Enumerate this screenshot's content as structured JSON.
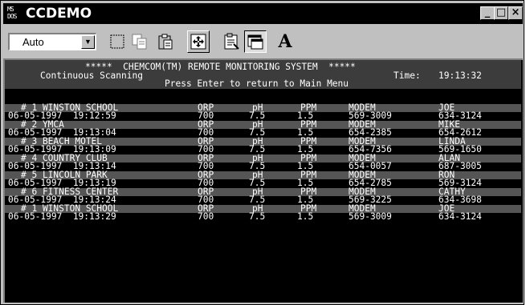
{
  "window": {
    "icon_top": "MS",
    "icon_bottom": "DOS",
    "title": "CCDEMO",
    "min_glyph": "_",
    "max_glyph": "□",
    "close_glyph": "×"
  },
  "toolbar": {
    "font_size_value": "Auto",
    "dropdown_glyph": "▼",
    "font_button_label": "A"
  },
  "terminal": {
    "header_line1": "*****  CHEMCOM(TM) REMOTE MONITORING SYSTEM  *****",
    "header_line2_left": "Continuous Scanning",
    "header_time_label": "Time:",
    "header_time_value": "19:13:32",
    "header_line3": "Press Enter to return to Main Menu",
    "columns": [
      "ORP",
      "pH",
      "PPM",
      "MODEM"
    ],
    "records": [
      {
        "site": "# 1 WINSTON SCHOOL",
        "datetime": "06-05-1997  19:12:59",
        "orp": "700",
        "ph": "7.5",
        "ppm": "1.5",
        "modem": "569-3009",
        "contact": "JOE",
        "phone": "634-3124"
      },
      {
        "site": "# 2 YMCA",
        "datetime": "06-05-1997  19:13:04",
        "orp": "700",
        "ph": "7.5",
        "ppm": "1.5",
        "modem": "654-2385",
        "contact": "MIKE",
        "phone": "654-2612"
      },
      {
        "site": "# 3 BEACH MOTEL",
        "datetime": "06-05-1997  19:13:09",
        "orp": "700",
        "ph": "7.5",
        "ppm": "1.5",
        "modem": "654-7356",
        "contact": "LINDA",
        "phone": "569-1650"
      },
      {
        "site": "# 4 COUNTRY CLUB",
        "datetime": "06-05-1997  19:13:14",
        "orp": "700",
        "ph": "7.5",
        "ppm": "1.5",
        "modem": "654-0057",
        "contact": "ALAN",
        "phone": "687-3005"
      },
      {
        "site": "# 5 LINCOLN PARK",
        "datetime": "06-05-1997  19:13:19",
        "orp": "700",
        "ph": "7.5",
        "ppm": "1.5",
        "modem": "654-2785",
        "contact": "RON",
        "phone": "569-3124"
      },
      {
        "site": "# 6 FITNESS CENTER",
        "datetime": "06-05-1997  19:13:24",
        "orp": "700",
        "ph": "7.5",
        "ppm": "1.5",
        "modem": "569-3225",
        "contact": "CATHY",
        "phone": "634-3698"
      },
      {
        "site": "# 1 WINSTON SCHOOL",
        "datetime": "06-05-1997  19:13:29",
        "orp": "700",
        "ph": "7.5",
        "ppm": "1.5",
        "modem": "569-3009",
        "contact": "JOE",
        "phone": "634-3124"
      }
    ]
  }
}
